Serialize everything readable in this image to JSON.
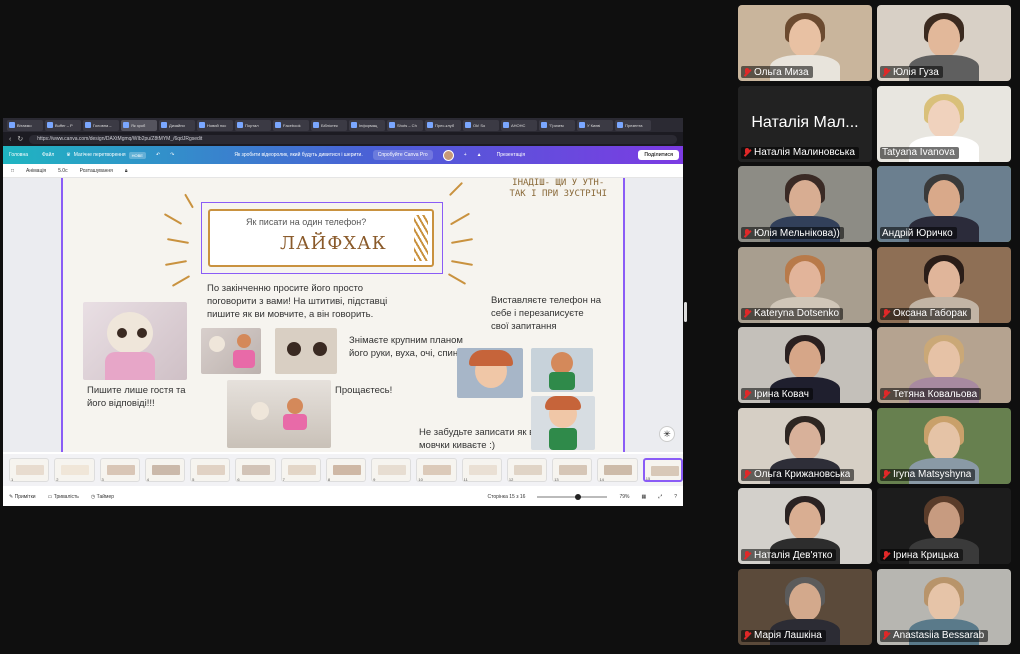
{
  "browser": {
    "tabs": [
      {
        "label": "Вітаємо",
        "active": false
      },
      {
        "label": "Buffer – P",
        "active": false
      },
      {
        "label": "Головна –",
        "active": false
      },
      {
        "label": "Як зроб",
        "active": true
      },
      {
        "label": "Дизайни",
        "active": false
      },
      {
        "label": "Новий пос",
        "active": false
      },
      {
        "label": "Портал",
        "active": false
      },
      {
        "label": "Facebook",
        "active": false
      },
      {
        "label": "Бібліотек",
        "active": false
      },
      {
        "label": "Інформац",
        "active": false
      },
      {
        "label": "Shots – Ch",
        "active": false
      },
      {
        "label": "Прес-клуб",
        "active": false
      },
      {
        "label": "Ok! So",
        "active": false
      },
      {
        "label": "АНОНС",
        "active": false
      },
      {
        "label": "\"Гризем",
        "active": false
      },
      {
        "label": "У Києві",
        "active": false
      },
      {
        "label": "Презента",
        "active": false
      }
    ],
    "url": "https://www.canva.com/design/DAXtMgmq/WIb2pu/Z8tMYM_/6qdJRgsedit"
  },
  "canva": {
    "menu_home": "Головна",
    "menu_file": "Файл",
    "magic_label": "Магічне перетворення",
    "new_badge": "НОВЕ",
    "hint": "Як зробити відеоролик, який будуть дивитися і шерити.",
    "try_pro": "Спробуйте Canva Pro",
    "present": "Презентація",
    "share": "Поділитися",
    "animation": "Анімація",
    "duration": "5.0с",
    "position": "Розташування"
  },
  "slide": {
    "top_right_line1": "ІНАДІШ- ЩИ У УТН-",
    "top_right_line2": "ТАК І ПРИ ЗУСТРІЧІ",
    "banner_question": "Як писати на один телефон?",
    "banner_title": "ЛАЙФХАК",
    "text_main": "По закінченню просите його просто поговорити з вами! На штитиві, підставці пишите як ви мовчите, а він говорить.",
    "text_right": "Виставляєте телефон на себе і перезаписуєте свої запитання",
    "text_left": "Пишите лише гостя та його відповіді!!!",
    "text_middle": "Знімаєте крупним планом його руки, вуха, очі, спину",
    "text_farewell": "Прощаєтесь!",
    "text_bottom": "Не забудьте записати як ви мовчки киваєте :)"
  },
  "thumbnails": [
    "1",
    "2",
    "3",
    "4",
    "5",
    "6",
    "7",
    "8",
    "9",
    "10",
    "11",
    "12",
    "13",
    "14",
    "15"
  ],
  "status": {
    "notes": "Примітки",
    "duration": "Тривалість",
    "timer": "Таймер",
    "page": "Сторінка 15 з 16",
    "zoom": "79%",
    "zoom_fraction": 0.54
  },
  "participants": [
    {
      "name": "Ольга Миза",
      "muted": true
    },
    {
      "name": "Юлія Гуза",
      "muted": true
    },
    {
      "name": "Наталія Малиновська",
      "muted": true,
      "no_video_label": "Наталія Мал..."
    },
    {
      "name": "Tatyana Ivanova",
      "muted": false
    },
    {
      "name": "Юлія Мельнікова))",
      "muted": true
    },
    {
      "name": "Андрій Юричко",
      "muted": false,
      "speaking": true
    },
    {
      "name": "Kateryna Dotsenko",
      "muted": true
    },
    {
      "name": "Оксана Габорак",
      "muted": true
    },
    {
      "name": "Ірина Ковач",
      "muted": true
    },
    {
      "name": "Тетяна Ковальова",
      "muted": true
    },
    {
      "name": "Ольга Крижановська",
      "muted": true
    },
    {
      "name": "Iryna Matsyshyna",
      "muted": true
    },
    {
      "name": "Наталія Дев'ятко",
      "muted": true
    },
    {
      "name": "Ірина Крицька",
      "muted": true
    },
    {
      "name": "Марія Лашкіна",
      "muted": true
    },
    {
      "name": "Anastasiia Bessarab",
      "muted": true
    }
  ],
  "colors": {
    "canva_accent": "#8a5cf6",
    "muted_mic": "#e02828",
    "speaking_outline": "#7ed321"
  }
}
